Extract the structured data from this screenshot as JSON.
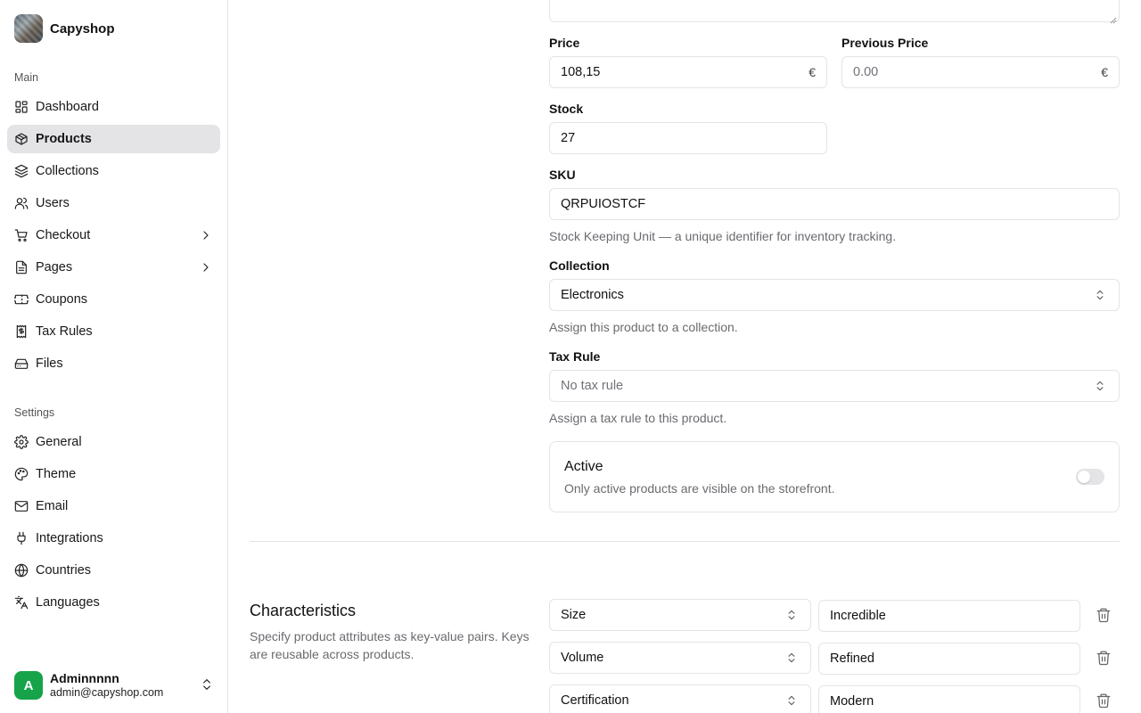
{
  "brand": {
    "name": "Capyshop"
  },
  "sidebar": {
    "main_label": "Main",
    "settings_label": "Settings",
    "main_items": [
      {
        "label": "Dashboard",
        "icon": "dashboard-icon"
      },
      {
        "label": "Products",
        "icon": "package-icon",
        "active": true
      },
      {
        "label": "Collections",
        "icon": "layers-icon"
      },
      {
        "label": "Users",
        "icon": "users-icon"
      },
      {
        "label": "Checkout",
        "icon": "cart-icon",
        "has_submenu": true
      },
      {
        "label": "Pages",
        "icon": "file-icon",
        "has_submenu": true
      },
      {
        "label": "Coupons",
        "icon": "ticket-icon"
      },
      {
        "label": "Tax Rules",
        "icon": "receipt-icon"
      },
      {
        "label": "Files",
        "icon": "hard-drive-icon"
      }
    ],
    "settings_items": [
      {
        "label": "General",
        "icon": "gear-icon"
      },
      {
        "label": "Theme",
        "icon": "palette-icon"
      },
      {
        "label": "Email",
        "icon": "mail-icon"
      },
      {
        "label": "Integrations",
        "icon": "plug-icon"
      },
      {
        "label": "Countries",
        "icon": "globe-icon"
      },
      {
        "label": "Languages",
        "icon": "languages-icon"
      }
    ]
  },
  "user": {
    "initial": "A",
    "name": "Adminnnnn",
    "email": "admin@capyshop.com"
  },
  "form": {
    "price": {
      "label": "Price",
      "value": "108,15",
      "suffix": "€"
    },
    "previous_price": {
      "label": "Previous Price",
      "placeholder": "0.00",
      "suffix": "€"
    },
    "stock": {
      "label": "Stock",
      "value": "27"
    },
    "sku": {
      "label": "SKU",
      "value": "QRPUIOSTCF",
      "help": "Stock Keeping Unit — a unique identifier for inventory tracking."
    },
    "collection": {
      "label": "Collection",
      "value": "Electronics",
      "help": "Assign this product to a collection."
    },
    "tax_rule": {
      "label": "Tax Rule",
      "value": "No tax rule",
      "help": "Assign a tax rule to this product."
    },
    "active": {
      "title": "Active",
      "description": "Only active products are visible on the storefront.",
      "enabled": false
    }
  },
  "characteristics": {
    "title": "Characteristics",
    "description": "Specify product attributes as key-value pairs. Keys are reusable across products.",
    "rows": [
      {
        "key": "Size",
        "value": "Incredible"
      },
      {
        "key": "Volume",
        "value": "Refined"
      },
      {
        "key": "Certification",
        "value": "Modern"
      }
    ]
  }
}
